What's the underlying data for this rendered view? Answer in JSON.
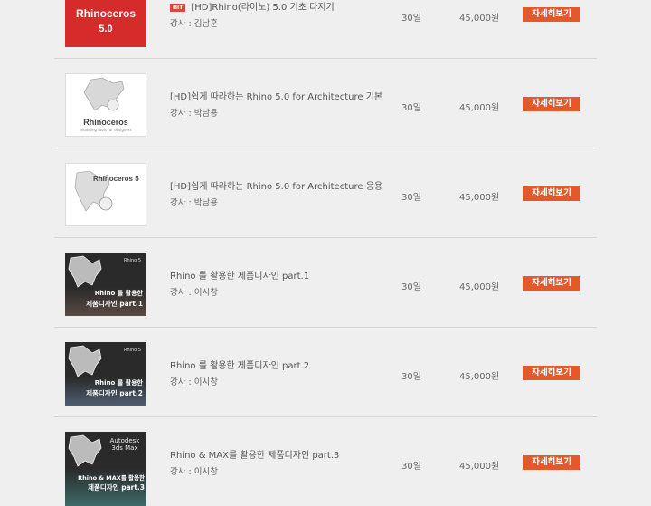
{
  "courses": [
    {
      "hit_badge": "HIT",
      "title": "[HD]Rhino(라이노) 5.0 기초 다지기",
      "instructor": "강사 : 김남훈",
      "period": "30일",
      "price": "45,000원",
      "button": "자세히보기",
      "thumb": {
        "style": "red",
        "line1": "Rhinoceros",
        "line2": "5.0",
        "color": "#d62b2b"
      }
    },
    {
      "title": "[HD]쉽게 따라하는 Rhino 5.0 for Architecture 기본",
      "instructor": "강사 : 박남용",
      "period": "30일",
      "price": "45,000원",
      "button": "자세히보기",
      "thumb": {
        "style": "white-logo",
        "line1": "Rhinoceros",
        "line2": "modeling tools for designers"
      }
    },
    {
      "title": "[HD]쉽게 따라하는 Rhino 5.0 for Architecture 응용",
      "instructor": "강사 : 박남용",
      "period": "30일",
      "price": "45,000원",
      "button": "자세히보기",
      "thumb": {
        "style": "white-5",
        "line1": "Rhinoceros 5"
      }
    },
    {
      "title": "Rhino 를 활용한 제품디자인 part.1",
      "instructor": "강사 : 이시창",
      "period": "30일",
      "price": "45,000원",
      "button": "자세히보기",
      "thumb": {
        "style": "dark",
        "corner": "Rhino 5",
        "line1": "Rhino 를 활용한",
        "line2": "제품디자인 part.1",
        "color": "#5a4a44"
      }
    },
    {
      "title": "Rhino 를 활용한 제품디자인 part.2",
      "instructor": "강사 : 이시창",
      "period": "30일",
      "price": "45,000원",
      "button": "자세히보기",
      "thumb": {
        "style": "dark",
        "corner": "Rhino 5",
        "line1": "Rhino 를 활용한",
        "line2": "제품디자인 part.2",
        "color": "#4e5e70"
      }
    },
    {
      "title": "Rhino & MAX를 활용한 제품디자인 part.3",
      "instructor": "강사 : 이시창",
      "period": "30일",
      "price": "45,000원",
      "button": "자세히보기",
      "thumb": {
        "style": "dark",
        "corner": "Autodesk 3ds Max",
        "line1": "Rhino & MAX를 활용한",
        "line2": "제품디자인 part.3",
        "color": "#3e6a6a"
      }
    }
  ]
}
